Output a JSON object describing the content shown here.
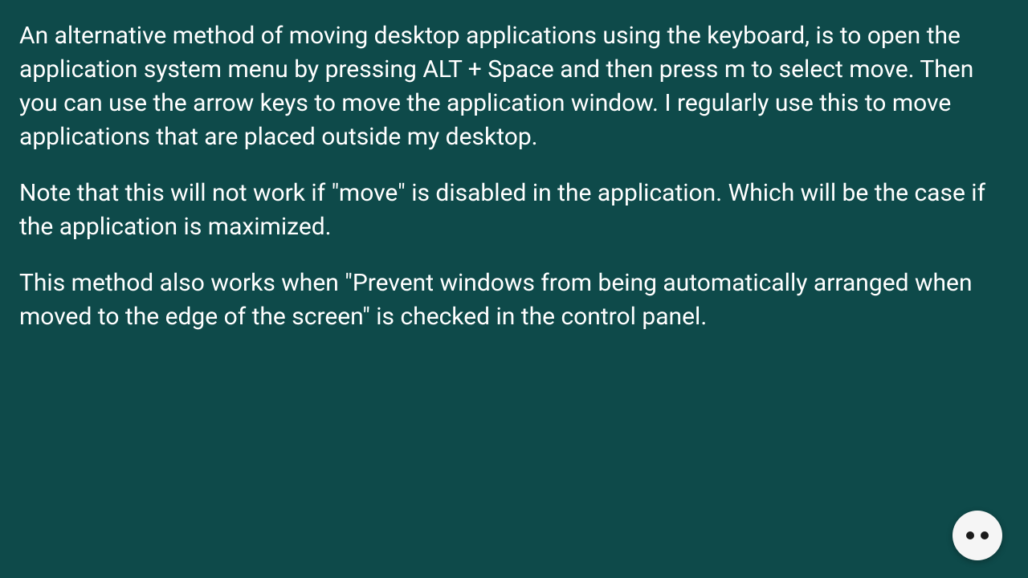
{
  "content": {
    "paragraphs": [
      "An alternative method of moving desktop applications using the keyboard, is to open the application system menu by pressing ALT + Space and then press m to select move. Then you can use the arrow keys to move the application window. I regularly use this to move applications that are placed outside my desktop.",
      "Note that this will not work if \"move\" is disabled in the application. Which will be the case if the application is maximized.",
      "This method also works when \"Prevent windows from being automatically arranged when moved to the edge of the screen\" is checked in the control panel."
    ]
  }
}
